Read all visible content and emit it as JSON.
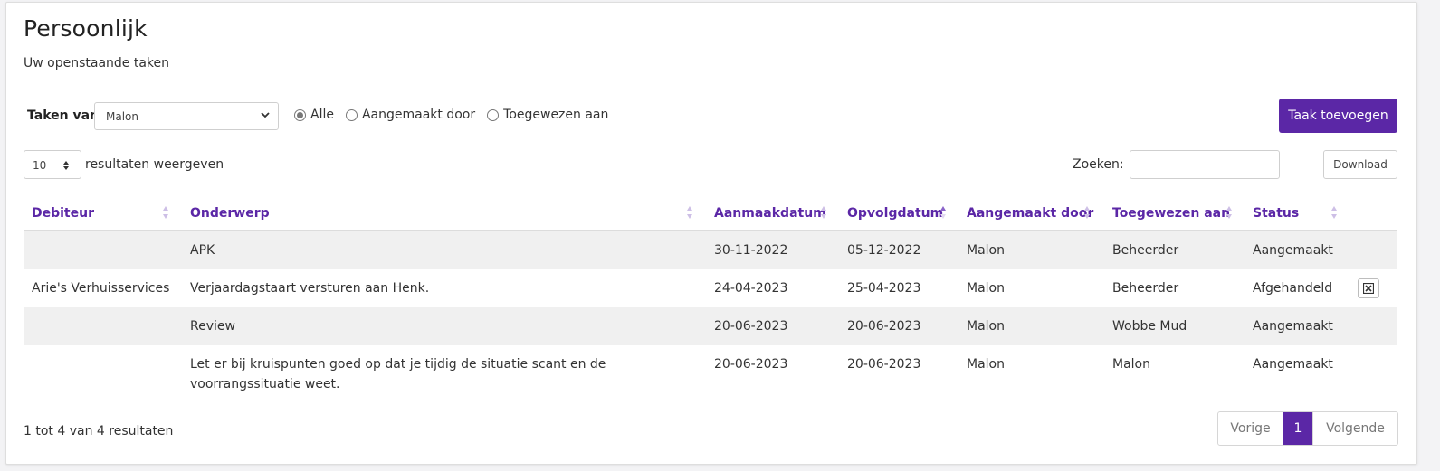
{
  "header": {
    "title": "Persoonlijk",
    "subtitle": "Uw openstaande taken"
  },
  "filters": {
    "label": "Taken van",
    "selected_user": "Malon",
    "radios": [
      {
        "label": "Alle",
        "checked": true
      },
      {
        "label": "Aangemaakt door",
        "checked": false
      },
      {
        "label": "Toegewezen aan",
        "checked": false
      }
    ],
    "add_button": "Taak toevoegen"
  },
  "controls": {
    "page_length": "10",
    "page_length_suffix": "resultaten weergeven",
    "search_label": "Zoeken:",
    "search_value": "",
    "download_label": "Download"
  },
  "table": {
    "columns": [
      "Debiteur",
      "Onderwerp",
      "Aanmaakdatum",
      "Opvolgdatum",
      "Aangemaakt door",
      "Toegewezen aan",
      "Status"
    ],
    "sorted_column": "Opvolgdatum",
    "sort_direction": "ascending",
    "rows": [
      {
        "debiteur": "",
        "onderwerp": "APK",
        "aanmaakdatum": "30-11-2022",
        "opvolgdatum": "05-12-2022",
        "aangemaakt_door": "Malon",
        "toegewezen_aan": "Beheerder",
        "status": "Aangemaakt"
      },
      {
        "debiteur": "Arie's Verhuisservices",
        "onderwerp": "Verjaardagstaart versturen aan Henk.",
        "aanmaakdatum": "24-04-2023",
        "opvolgdatum": "25-04-2023",
        "aangemaakt_door": "Malon",
        "toegewezen_aan": "Beheerder",
        "status": "Afgehandeld"
      },
      {
        "debiteur": "",
        "onderwerp": "Review",
        "aanmaakdatum": "20-06-2023",
        "opvolgdatum": "20-06-2023",
        "aangemaakt_door": "Malon",
        "toegewezen_aan": "Wobbe Mud",
        "status": "Aangemaakt"
      },
      {
        "debiteur": "",
        "onderwerp": "Let er bij kruispunten goed op dat je tijdig de situatie scant en de voorrangssituatie weet.",
        "aanmaakdatum": "20-06-2023",
        "opvolgdatum": "20-06-2023",
        "aangemaakt_door": "Malon",
        "toegewezen_aan": "Malon",
        "status": "Aangemaakt"
      }
    ]
  },
  "footer": {
    "info": "1 tot 4 van 4 resultaten",
    "prev": "Vorige",
    "current_page": "1",
    "next": "Volgende"
  },
  "colors": {
    "accent": "#5b27a6",
    "row_shade": "#f0f0f0"
  }
}
